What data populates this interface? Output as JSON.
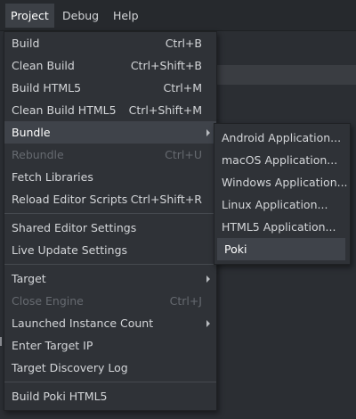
{
  "menubar": {
    "items": [
      {
        "label": "Project",
        "active": true
      },
      {
        "label": "Debug",
        "active": false
      },
      {
        "label": "Help",
        "active": false
      }
    ]
  },
  "project_menu": {
    "build": {
      "label": "Build",
      "shortcut": "Ctrl+B"
    },
    "clean_build": {
      "label": "Clean Build",
      "shortcut": "Ctrl+Shift+B"
    },
    "build_html5": {
      "label": "Build HTML5",
      "shortcut": "Ctrl+M"
    },
    "clean_build_html5": {
      "label": "Clean Build HTML5",
      "shortcut": "Ctrl+Shift+M"
    },
    "bundle": {
      "label": "Bundle"
    },
    "rebundle": {
      "label": "Rebundle",
      "shortcut": "Ctrl+U"
    },
    "fetch_libraries": {
      "label": "Fetch Libraries"
    },
    "reload_editor_scripts": {
      "label": "Reload Editor Scripts",
      "shortcut": "Ctrl+Shift+R"
    },
    "shared_editor_settings": {
      "label": "Shared Editor Settings"
    },
    "live_update_settings": {
      "label": "Live Update Settings"
    },
    "target": {
      "label": "Target"
    },
    "close_engine": {
      "label": "Close Engine",
      "shortcut": "Ctrl+J"
    },
    "launched_instance_count": {
      "label": "Launched Instance Count"
    },
    "enter_target_ip": {
      "label": "Enter Target IP"
    },
    "target_discovery_log": {
      "label": "Target Discovery Log"
    },
    "build_poki_html5": {
      "label": "Build Poki HTML5"
    }
  },
  "bundle_submenu": {
    "items": [
      {
        "label": "Android Application..."
      },
      {
        "label": "macOS Application..."
      },
      {
        "label": "Windows Application..."
      },
      {
        "label": "Linux Application..."
      },
      {
        "label": "HTML5 Application..."
      },
      {
        "label": "Poki"
      }
    ]
  },
  "colors": {
    "menu_bg": "#2f3237",
    "highlight": "#3f434a",
    "text": "#d4d6d9",
    "disabled_text": "#666a70",
    "menubar_bg": "#26292d"
  }
}
